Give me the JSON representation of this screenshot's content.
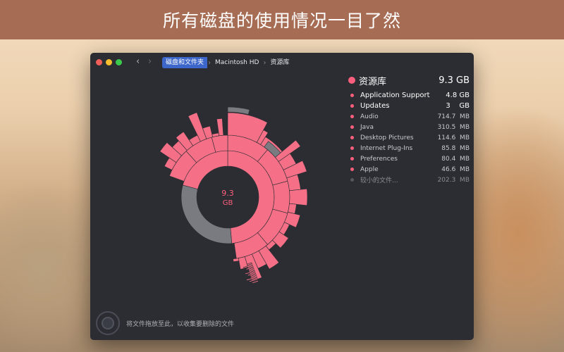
{
  "banner": {
    "title": "所有磁盘的使用情况一目了然"
  },
  "nav": {
    "back": "‹",
    "forward": "›"
  },
  "breadcrumb": [
    "磁盘和文件夹",
    "Macintosh HD",
    "资源库"
  ],
  "chart_center": {
    "size": "9.3",
    "unit": "GB"
  },
  "legend": {
    "header": {
      "name": "资源库",
      "size": "9.3 GB"
    },
    "items": [
      {
        "name": "Application Support",
        "size": "4.8 GB",
        "big": true
      },
      {
        "name": "Updates",
        "size": "3    GB",
        "big": true
      },
      {
        "name": "Audio",
        "size": "714.7  MB",
        "big": false
      },
      {
        "name": "Java",
        "size": "310.5  MB",
        "big": false
      },
      {
        "name": "Desktop Pictures",
        "size": "114.6  MB",
        "big": false
      },
      {
        "name": "Internet Plug-Ins",
        "size": "85.8  MB",
        "big": false
      },
      {
        "name": "Preferences",
        "size": "80.4  MB",
        "big": false
      },
      {
        "name": "Apple",
        "size": "46.6  MB",
        "big": false
      },
      {
        "name": "较小的文件...",
        "size": "202.3  MB",
        "big": false,
        "dim": true
      }
    ]
  },
  "dropzone": {
    "text": "将文件拖放至此，以收集要删除的文件"
  },
  "colors": {
    "accent": "#ff5f7c",
    "pink": "#f56f86",
    "gray": "#7a7b80",
    "window_bg": "#2b2d33",
    "banner_bg": "#a66d54",
    "breadcrumb_active": "#3c66c9"
  }
}
